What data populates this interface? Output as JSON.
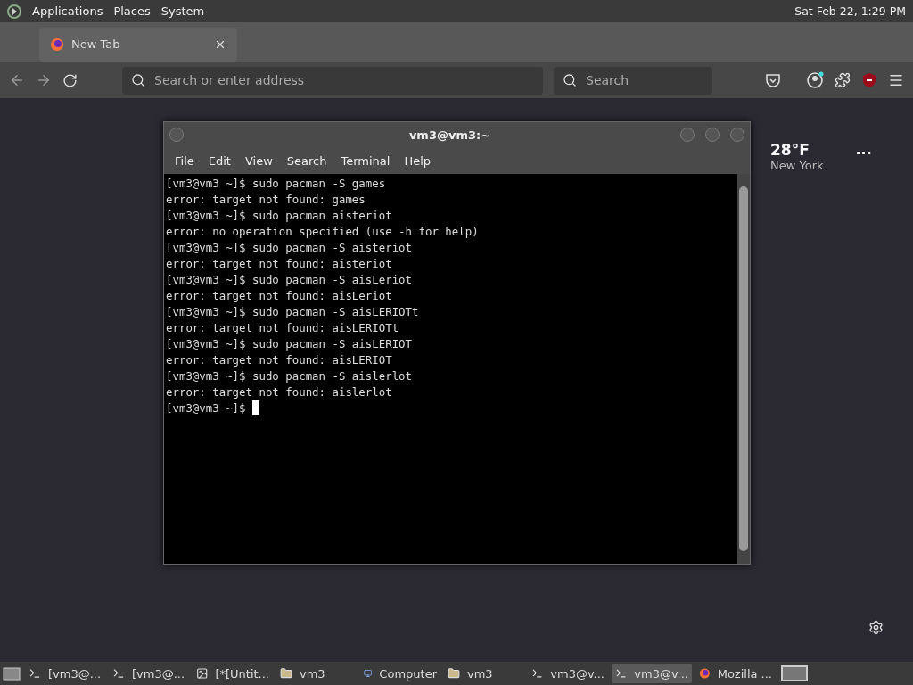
{
  "top_panel": {
    "menus": [
      "Applications",
      "Places",
      "System"
    ],
    "clock": "Sat Feb 22,  1:29 PM"
  },
  "browser": {
    "tab": {
      "title": "New Tab"
    },
    "address": {
      "placeholder": "Search or enter address"
    },
    "search": {
      "placeholder": "Search"
    },
    "weather": {
      "temperature": "28°F",
      "city": "New York",
      "menu": "..."
    }
  },
  "terminal": {
    "title": "vm3@vm3:~",
    "menus": [
      "File",
      "Edit",
      "View",
      "Search",
      "Terminal",
      "Help"
    ],
    "lines": [
      "[vm3@vm3 ~]$ sudo pacman -S games",
      "error: target not found: games",
      "[vm3@vm3 ~]$ sudo pacman aisteriot",
      "error: no operation specified (use -h for help)",
      "[vm3@vm3 ~]$ sudo pacman -S aisteriot",
      "error: target not found: aisteriot",
      "[vm3@vm3 ~]$ sudo pacman -S aisLeriot",
      "error: target not found: aisLeriot",
      "[vm3@vm3 ~]$ sudo pacman -S aisLERIOTt",
      "error: target not found: aisLERIOTt",
      "[vm3@vm3 ~]$ sudo pacman -S aisLERIOT",
      "error: target not found: aisLERIOT",
      "[vm3@vm3 ~]$ sudo pacman -S aislerlot",
      "error: target not found: aislerlot"
    ],
    "prompt": "[vm3@vm3 ~]$ ",
    "cursor": true
  },
  "taskbar": [
    {
      "label": "[vm3@...",
      "kind": "terminal",
      "selected": false
    },
    {
      "label": "[vm3@...",
      "kind": "terminal",
      "selected": false
    },
    {
      "label": "[*[Untit...",
      "kind": "editor",
      "selected": false
    },
    {
      "label": "vm3",
      "kind": "folder",
      "selected": false
    },
    {
      "label": "Computer",
      "kind": "computer",
      "selected": false
    },
    {
      "label": "vm3",
      "kind": "folder",
      "selected": false
    },
    {
      "label": "vm3@v...",
      "kind": "terminal",
      "selected": false
    },
    {
      "label": "vm3@v...",
      "kind": "terminal",
      "selected": true
    },
    {
      "label": "Mozilla ...",
      "kind": "browser",
      "selected": false
    }
  ]
}
